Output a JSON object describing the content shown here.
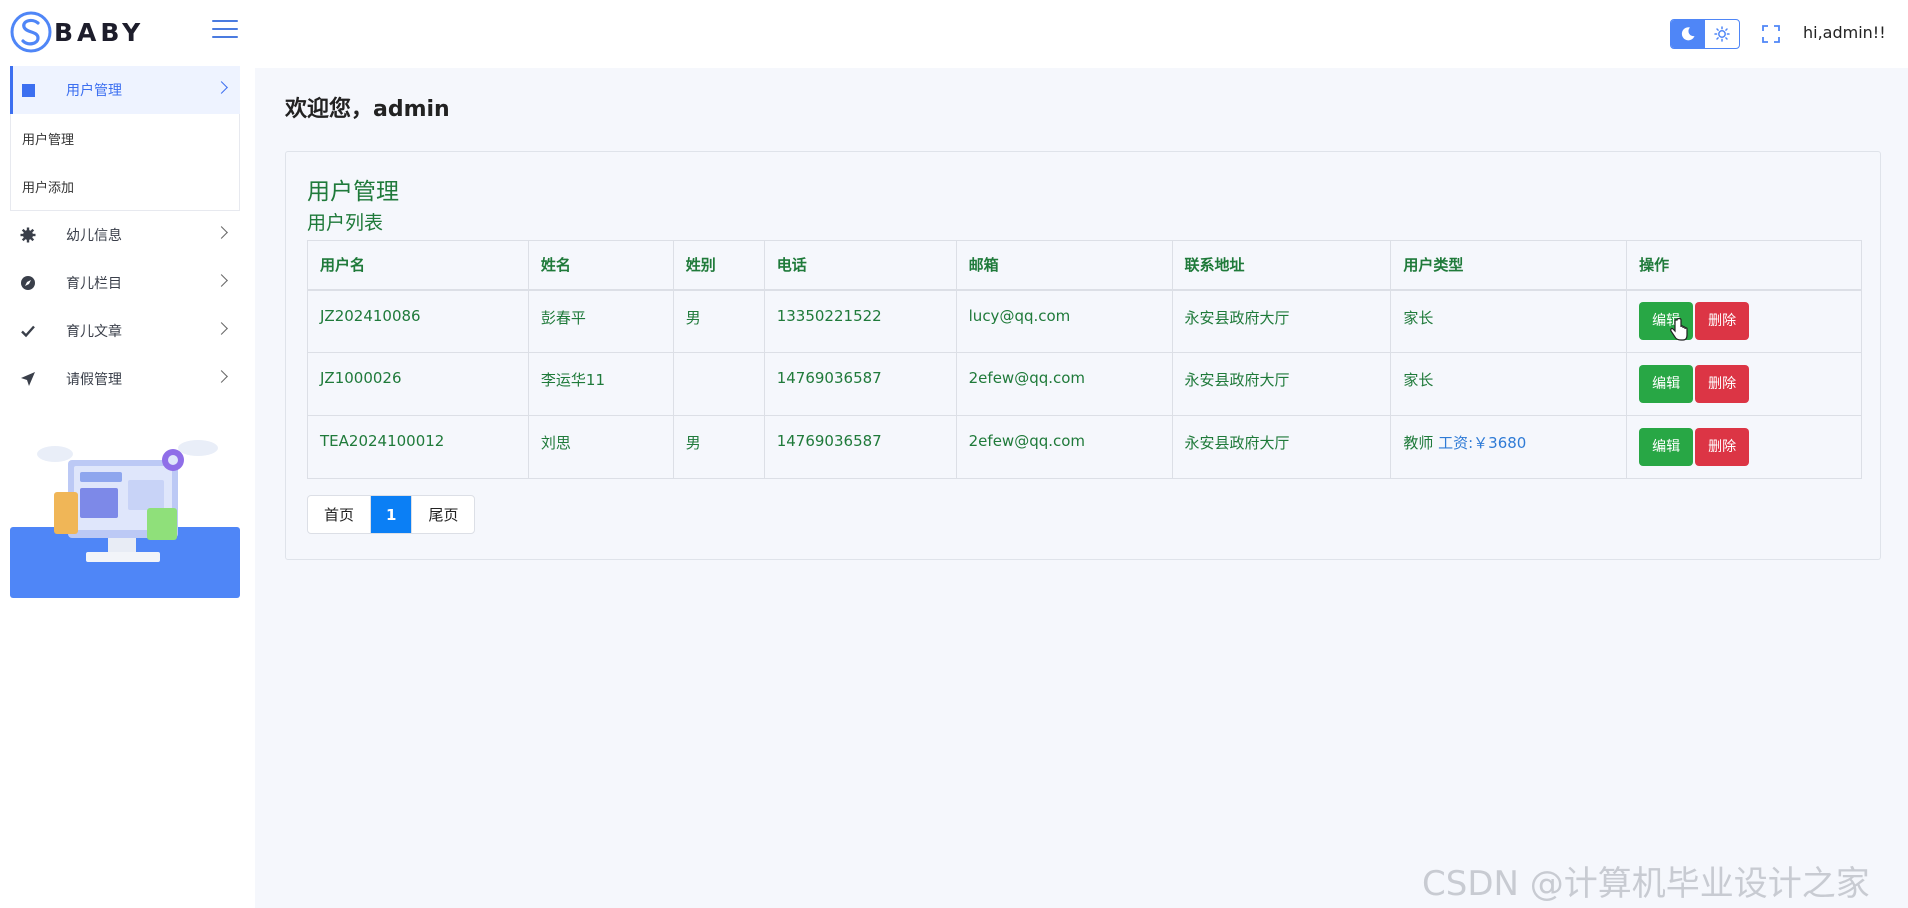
{
  "app": {
    "logo_letter": "S",
    "logo_text": "BABY"
  },
  "header": {
    "greeting": "hi,admin!!",
    "theme_icons": [
      "moon-icon",
      "sun-icon"
    ],
    "fullscreen_icon": "expand-icon"
  },
  "sidebar": {
    "items": [
      {
        "label": "用户管理",
        "icon": "square-icon",
        "active": true,
        "children": [
          {
            "label": "用户管理"
          },
          {
            "label": "用户添加"
          }
        ]
      },
      {
        "label": "幼儿信息",
        "icon": "gear-icon"
      },
      {
        "label": "育儿栏目",
        "icon": "compass-icon"
      },
      {
        "label": "育儿文章",
        "icon": "check-icon"
      },
      {
        "label": "请假管理",
        "icon": "send-icon"
      }
    ]
  },
  "main": {
    "welcome": "欢迎您，admin",
    "panel_title": "用户管理",
    "panel_subtitle": "用户列表",
    "table": {
      "headers": [
        "用户名",
        "姓名",
        "姓别",
        "电话",
        "邮箱",
        "联系地址",
        "用户类型",
        "操作"
      ],
      "rows": [
        {
          "username": "JZ202410086",
          "name": "彭春平",
          "gender": "男",
          "phone": "13350221522",
          "email": "lucy@qq.com",
          "address": "永安县政府大厅",
          "type": "家长",
          "extra": ""
        },
        {
          "username": "JZ1000026",
          "name": "李运华11",
          "gender": "",
          "phone": "14769036587",
          "email": "2efew@qq.com",
          "address": "永安县政府大厅",
          "type": "家长",
          "extra": ""
        },
        {
          "username": "TEA2024100012",
          "name": "刘思",
          "gender": "男",
          "phone": "14769036587",
          "email": "2efew@qq.com",
          "address": "永安县政府大厅",
          "type": "教师",
          "extra": "工资:￥3680"
        }
      ],
      "edit_label": "编辑",
      "delete_label": "删除"
    },
    "pagination": {
      "first": "首页",
      "current": "1",
      "last": "尾页"
    }
  },
  "watermark": "CSDN @计算机毕业设计之家",
  "colors": {
    "accent": "#3c6ff0",
    "table_text": "#1f7a3a",
    "edit_button": "#28a745",
    "delete_button": "#dc3545",
    "page_current": "#0b7ff5"
  }
}
